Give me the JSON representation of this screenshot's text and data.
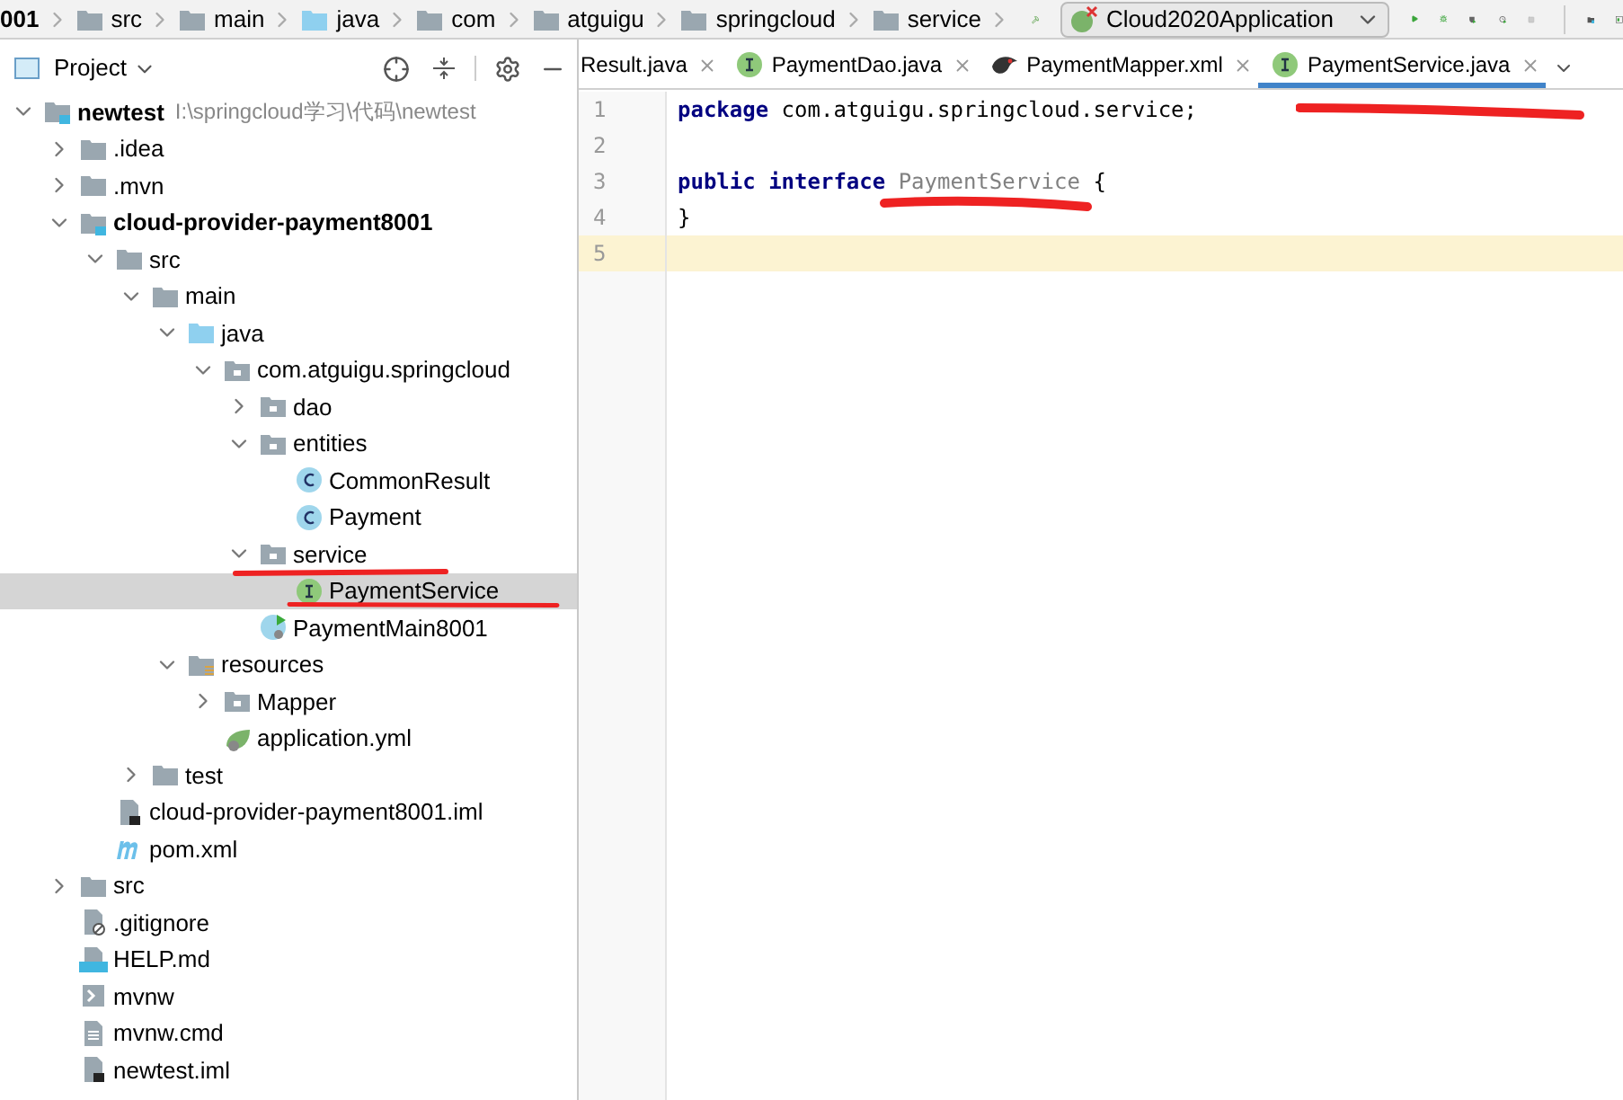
{
  "breadcrumb": [
    "001",
    "src",
    "main",
    "java",
    "com",
    "atguigu",
    "springcloud",
    "service"
  ],
  "run_config": {
    "label": "Cloud2020Application"
  },
  "project_panel": {
    "title": "Project"
  },
  "tree": [
    {
      "name": "newtest",
      "path": "I:\\springcloud学习\\代码\\newtest",
      "kind": "module",
      "bold": true,
      "expanded": true,
      "selected": false,
      "children": [
        {
          "name": ".idea",
          "kind": "folder",
          "expanded": false,
          "selected": false
        },
        {
          "name": ".mvn",
          "kind": "folder",
          "expanded": false,
          "selected": false
        },
        {
          "name": "cloud-provider-payment8001",
          "kind": "module",
          "bold": true,
          "expanded": true,
          "selected": false,
          "children": [
            {
              "name": "src",
              "kind": "folder",
              "expanded": true,
              "selected": false,
              "children": [
                {
                  "name": "main",
                  "kind": "folder",
                  "expanded": true,
                  "selected": false,
                  "children": [
                    {
                      "name": "java",
                      "kind": "source",
                      "expanded": true,
                      "selected": false,
                      "children": [
                        {
                          "name": "com.atguigu.springcloud",
                          "kind": "package",
                          "expanded": true,
                          "selected": false,
                          "children": [
                            {
                              "name": "dao",
                              "kind": "package",
                              "expanded": false,
                              "selected": false
                            },
                            {
                              "name": "entities",
                              "kind": "package",
                              "expanded": true,
                              "selected": false,
                              "children": [
                                {
                                  "name": "CommonResult",
                                  "kind": "class",
                                  "selected": false
                                },
                                {
                                  "name": "Payment",
                                  "kind": "class",
                                  "selected": false
                                }
                              ]
                            },
                            {
                              "name": "service",
                              "kind": "package",
                              "expanded": true,
                              "selected": false,
                              "children": [
                                {
                                  "name": "PaymentService",
                                  "kind": "interface",
                                  "selected": true
                                }
                              ]
                            },
                            {
                              "name": "PaymentMain8001",
                              "kind": "main-class",
                              "selected": false
                            }
                          ]
                        }
                      ]
                    },
                    {
                      "name": "resources",
                      "kind": "resources",
                      "expanded": true,
                      "selected": false,
                      "children": [
                        {
                          "name": "Mapper",
                          "kind": "package",
                          "expanded": false,
                          "selected": false
                        },
                        {
                          "name": "application.yml",
                          "kind": "yml",
                          "selected": false
                        }
                      ]
                    }
                  ]
                },
                {
                  "name": "test",
                  "kind": "folder",
                  "expanded": false,
                  "selected": false
                }
              ]
            },
            {
              "name": "cloud-provider-payment8001.iml",
              "kind": "iml",
              "selected": false
            },
            {
              "name": "pom.xml",
              "kind": "maven",
              "selected": false
            }
          ]
        },
        {
          "name": "src",
          "kind": "folder",
          "expanded": false,
          "selected": false
        },
        {
          "name": ".gitignore",
          "kind": "gitignore",
          "selected": false
        },
        {
          "name": "HELP.md",
          "kind": "md",
          "selected": false
        },
        {
          "name": "mvnw",
          "kind": "script",
          "selected": false
        },
        {
          "name": "mvnw.cmd",
          "kind": "text",
          "selected": false
        },
        {
          "name": "newtest.iml",
          "kind": "iml",
          "selected": false
        }
      ]
    }
  ],
  "editor_tabs": [
    {
      "label": "Result.java",
      "selected": false
    },
    {
      "label": "PaymentDao.java",
      "kind": "interface",
      "selected": false
    },
    {
      "label": "PaymentMapper.xml",
      "kind": "mybatis",
      "selected": false
    },
    {
      "label": "PaymentService.java",
      "kind": "interface",
      "selected": true
    }
  ],
  "code_lines": [
    {
      "number": "1",
      "current": false,
      "tokens": [
        {
          "kind": "keyword",
          "text": "package"
        },
        {
          "kind": "plain",
          "text": " com.atguigu.springcloud.service;"
        }
      ]
    },
    {
      "number": "2",
      "current": false
    },
    {
      "number": "3",
      "current": false,
      "tokens": [
        {
          "kind": "keyword",
          "text": "public interface"
        },
        {
          "kind": "unused",
          "text": " PaymentService"
        },
        {
          "kind": "plain",
          "text": " {"
        }
      ]
    },
    {
      "number": "4",
      "current": false,
      "tokens": [
        {
          "kind": "plain",
          "text": "}"
        }
      ]
    },
    {
      "number": "5",
      "current": true
    }
  ]
}
